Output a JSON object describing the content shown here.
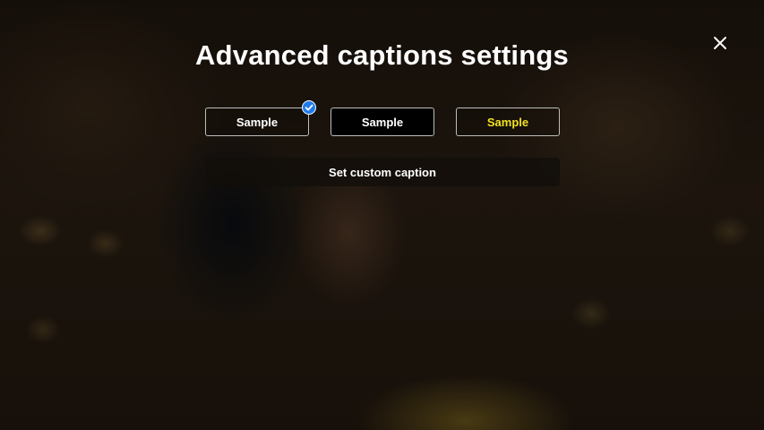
{
  "dialog": {
    "title": "Advanced captions settings",
    "close_icon": "close-icon"
  },
  "caption_styles": [
    {
      "label": "Sample",
      "text_color": "#ffffff",
      "background": "transparent",
      "selected": true
    },
    {
      "label": "Sample",
      "text_color": "#ffffff",
      "background": "#000000",
      "selected": false
    },
    {
      "label": "Sample",
      "text_color": "#f2e01f",
      "background": "transparent",
      "selected": false
    }
  ],
  "selected_icon": "checkmark-icon",
  "custom_caption_label": "Set custom caption",
  "colors": {
    "accent": "#1f7bea",
    "yellow_caption": "#f2e01f"
  }
}
